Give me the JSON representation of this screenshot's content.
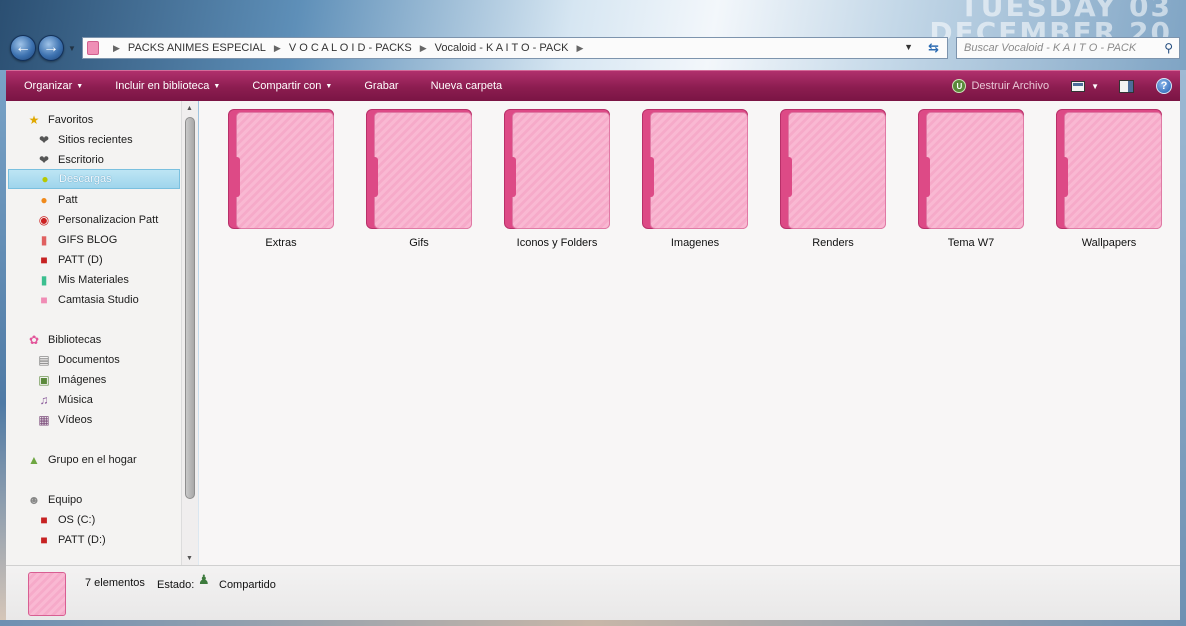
{
  "wallpaper": {
    "line1": "TUESDAY 03",
    "line2": "DECEMBER 20"
  },
  "address": {
    "crumbs": [
      "PACKS ANIMES ESPECIAL",
      "V O C A L O I D - PACKS",
      "Vocaloid - K A I T O - PACK"
    ]
  },
  "search": {
    "placeholder": "Buscar Vocaloid - K A I T O - PACK"
  },
  "toolbar": {
    "organize": "Organizar",
    "include": "Incluir en biblioteca",
    "share": "Compartir con",
    "burn": "Grabar",
    "new_folder": "Nueva carpeta",
    "destroy": "Destruir Archivo"
  },
  "nav": {
    "favorites": "Favoritos",
    "recent": "Sitios recientes",
    "desktop": "Escritorio",
    "downloads": "Descargas",
    "patt": "Patt",
    "personalization": "Personalizacion Patt",
    "gifs_blog": "GIFS BLOG",
    "patt_d": "PATT (D)",
    "materials": "Mis Materiales",
    "camtasia": "Camtasia Studio",
    "libraries": "Bibliotecas",
    "documents": "Documentos",
    "images": "Imágenes",
    "music": "Música",
    "videos": "Vídeos",
    "homegroup": "Grupo en el hogar",
    "computer": "Equipo",
    "drive_c": "OS (C:)",
    "drive_d": "PATT (D:)"
  },
  "folders": [
    "Extras",
    "Gifs",
    "Iconos y Folders",
    "Imagenes",
    "Renders",
    "Tema W7",
    "Wallpapers"
  ],
  "status": {
    "count": "7 elementos",
    "state_label": "Estado:",
    "state_value": "Compartido"
  },
  "colors": {
    "toolbar": "#8c1d50",
    "folder_pink": "#f9b8d2",
    "folder_dark": "#dd4a86"
  }
}
